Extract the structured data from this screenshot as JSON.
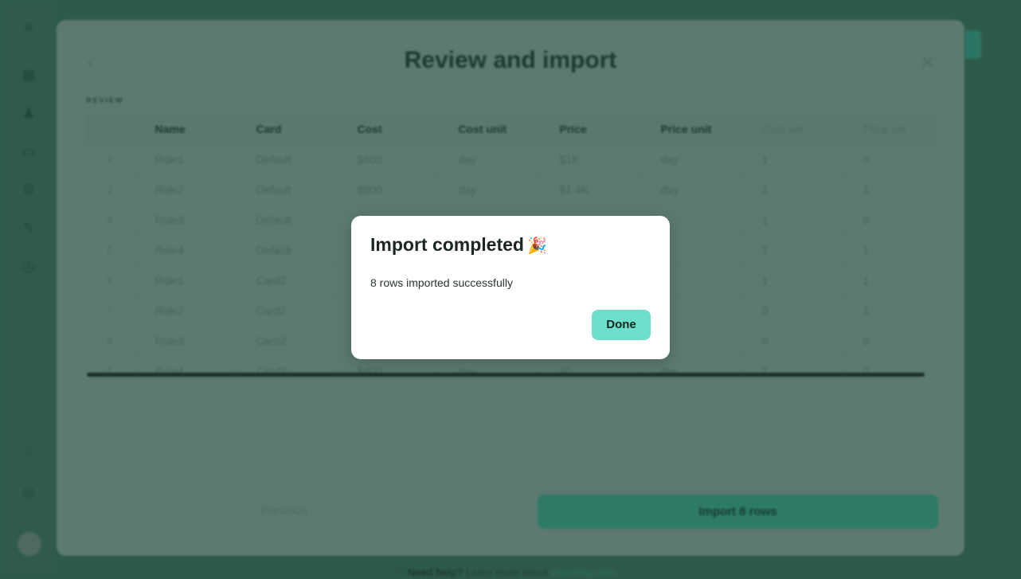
{
  "modal": {
    "title": "Review and import",
    "section_label": "REVIEW",
    "table": {
      "columns": [
        "",
        "Name",
        "Card",
        "Cost",
        "Cost unit",
        "Price",
        "Price unit",
        "Cost set",
        "Price set"
      ],
      "rows": [
        [
          "2",
          "Role1",
          "Default",
          "$500",
          "day",
          "$1K",
          "day",
          "1",
          "0"
        ],
        [
          "3",
          "Role2",
          "Default",
          "$800",
          "day",
          "$1.4K",
          "day",
          "1",
          "1"
        ],
        [
          "4",
          "Role3",
          "Default",
          "",
          "",
          "",
          "",
          "1",
          "0"
        ],
        [
          "5",
          "Role4",
          "Default",
          "",
          "",
          "",
          "",
          "1",
          "1"
        ],
        [
          "6",
          "Role1",
          "Card2",
          "",
          "",
          "",
          "",
          "1",
          "1"
        ],
        [
          "7",
          "Role2",
          "Card2",
          "",
          "",
          "",
          "",
          "0",
          "1"
        ],
        [
          "8",
          "Role3",
          "Card2",
          "",
          "",
          "",
          "",
          "0",
          "0"
        ],
        [
          "9",
          "Role4",
          "Card2",
          "$400",
          "day",
          "$0",
          "day",
          "1",
          "0"
        ]
      ]
    },
    "previous_label": "Previous",
    "import_label": "Import 8 rows"
  },
  "footer": {
    "bold_text": "Need help?",
    "text": "Learn more about",
    "link": "importing data"
  },
  "dialog": {
    "title": "Import completed",
    "emoji": "🎉",
    "message": "8 rows imported successfully",
    "done_label": "Done"
  },
  "colors": {
    "accent": "#6edfca",
    "backdrop": "#2e5a4c",
    "dialog_bg": "#ffffff"
  }
}
